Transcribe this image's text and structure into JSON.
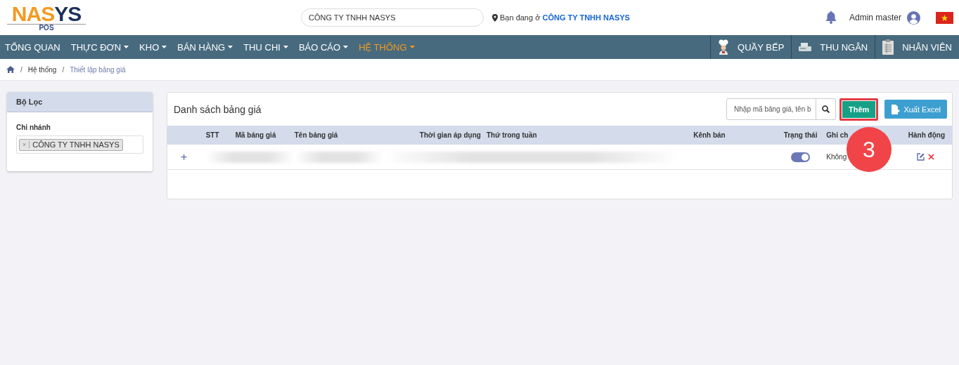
{
  "header": {
    "logo": {
      "main_left": "NA",
      "main_mid": "S",
      "main_right": "YS",
      "sub": "POS"
    },
    "company_search": {
      "value": "CÔNG TY TNHH NASYS"
    },
    "location": {
      "prefix": "Bạn đang ở",
      "company": "CÔNG TY TNHH NASYS"
    },
    "user": {
      "name": "Admin master"
    }
  },
  "nav": {
    "items": [
      {
        "label": "TỔNG QUAN",
        "dropdown": false,
        "selected": false
      },
      {
        "label": "THỰC ĐƠN",
        "dropdown": true,
        "selected": false
      },
      {
        "label": "KHO",
        "dropdown": true,
        "selected": false
      },
      {
        "label": "BÁN HÀNG",
        "dropdown": true,
        "selected": false
      },
      {
        "label": "THU CHI",
        "dropdown": true,
        "selected": false
      },
      {
        "label": "BÁO CÁO",
        "dropdown": true,
        "selected": false
      },
      {
        "label": "HỆ THỐNG",
        "dropdown": true,
        "selected": true
      }
    ],
    "right_items": [
      {
        "label": "QUẦY BẾP",
        "kind": "chef"
      },
      {
        "label": "THU NGÂN",
        "kind": "register"
      },
      {
        "label": "NHÂN VIÊN",
        "kind": "clipboard"
      }
    ]
  },
  "breadcrumb": {
    "separator": "/",
    "items": [
      "Hệ thống",
      "Thiết lập bảng giá"
    ]
  },
  "filter": {
    "title": "Bộ Lọc",
    "field_label": "Chi nhánh",
    "tags": [
      {
        "remove": "×",
        "label": "CÔNG TY TNHH NASYS"
      }
    ]
  },
  "list": {
    "title": "Danh sách bảng giá",
    "search_placeholder": "Nhập mã bảng giá, tên b",
    "add_button": {
      "label": "Thêm",
      "highlighted": true
    },
    "export_button": "Xuất Excel",
    "columns": [
      "STT",
      "Mã bảng giá",
      "Tên bảng giá",
      "Thời gian áp dụng",
      "Thứ trong tuần",
      "Kênh bán",
      "Trạng thái",
      "Ghi ch",
      "Hành động"
    ],
    "rows": [
      {
        "expand": "+",
        "on": true,
        "note": "Không"
      }
    ]
  },
  "step_badge": "3"
}
